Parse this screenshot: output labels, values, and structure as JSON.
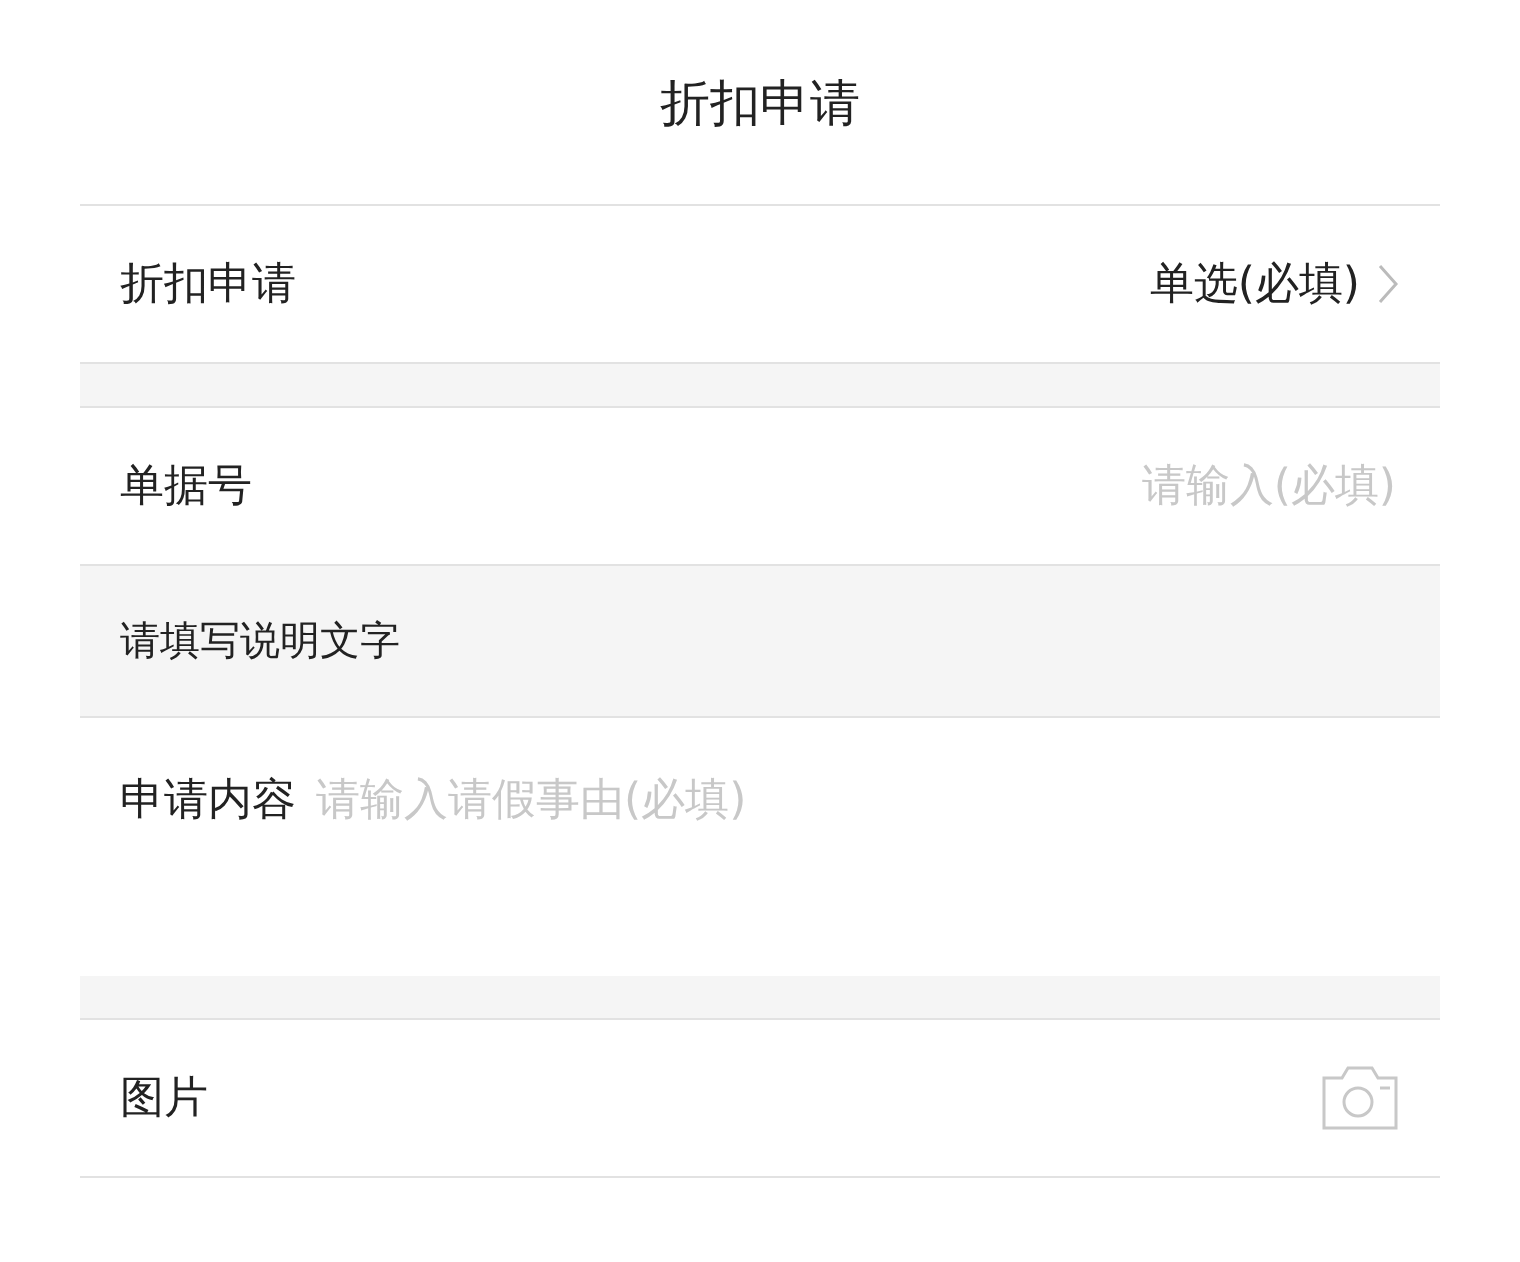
{
  "header": {
    "title": "折扣申请"
  },
  "select_row": {
    "label": "折扣申请",
    "value": "单选(必填)"
  },
  "number_row": {
    "label": "单据号",
    "placeholder": "请输入(必填)"
  },
  "note": {
    "text": "请填写说明文字"
  },
  "content_row": {
    "label": "申请内容",
    "placeholder": "请输入请假事由(必填)"
  },
  "image_row": {
    "label": "图片"
  }
}
